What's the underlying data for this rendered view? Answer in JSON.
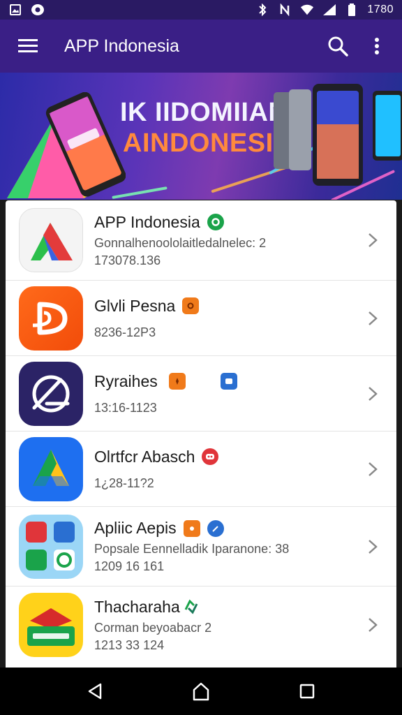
{
  "status_bar": {
    "left_icons": [
      "image-icon",
      "notification-icon"
    ],
    "right_icons": [
      "bluetooth-icon",
      "nfc-icon",
      "wifi-icon",
      "signal-icon",
      "battery-icon"
    ],
    "time": "1780"
  },
  "app_bar": {
    "title": "APP Indonesia",
    "menu_icon": "menu-icon",
    "search_icon": "search-icon",
    "more_icon": "more-vert-icon"
  },
  "banner": {
    "line1": "IK IIDOMIIAN",
    "line2": "AINDONESIA"
  },
  "apps": [
    {
      "name": "APP Indonesia",
      "desc": "Gonnalhenoololaitledalnelec: 2",
      "meta": "173078.136",
      "badges": [
        "#1aa34a"
      ]
    },
    {
      "name": "Glvli Pesna",
      "desc": "",
      "meta": "8236-12P3",
      "badges": [
        "#f07a1a"
      ]
    },
    {
      "name": "Ryraihes",
      "desc": "",
      "meta": "13:16-1123",
      "badges": [
        "#f07a1a",
        "#2a6fd1"
      ]
    },
    {
      "name": "Olrtfcr Abasch",
      "desc": "",
      "meta": "1¿28-11?2",
      "badges": [
        "#e0353a"
      ]
    },
    {
      "name": "Apliic Aepis",
      "desc": "Popsale Eennelladik Iparanone: 38",
      "meta": "1209 16 161",
      "badges": [
        "#f07a1a",
        "#2a6fd1"
      ]
    },
    {
      "name": "Thacharaha",
      "desc": "Corman beyoabacr 2",
      "meta": "1213 33 124",
      "badges": [
        "#1aa34a"
      ]
    }
  ],
  "nav_bar": {
    "back": "back-icon",
    "home": "home-icon",
    "recents": "recents-icon"
  }
}
